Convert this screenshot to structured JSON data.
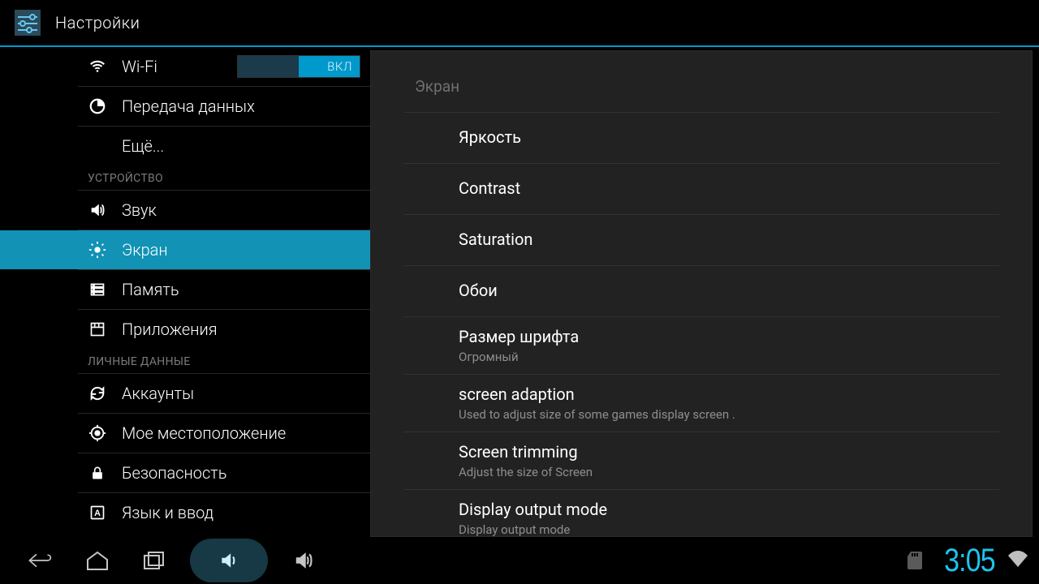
{
  "app": {
    "title": "Настройки"
  },
  "toggle": {
    "on_label": "ВКЛ"
  },
  "sidebar": {
    "items": [
      {
        "label": "Wi-Fi"
      },
      {
        "label": "Передача данных"
      },
      {
        "label": "Ещё..."
      },
      {
        "label": "Звук"
      },
      {
        "label": "Экран"
      },
      {
        "label": "Память"
      },
      {
        "label": "Приложения"
      },
      {
        "label": "Аккаунты"
      },
      {
        "label": "Мое местоположение"
      },
      {
        "label": "Безопасность"
      },
      {
        "label": "Язык и ввод"
      }
    ],
    "sections": {
      "device": "УСТРОЙСТВО",
      "personal": "ЛИЧНЫЕ ДАННЫЕ"
    }
  },
  "panel": {
    "header": "Экран",
    "rows": [
      {
        "title": "Яркость"
      },
      {
        "title": "Contrast"
      },
      {
        "title": "Saturation"
      },
      {
        "title": "Обои"
      },
      {
        "title": "Размер шрифта",
        "sub": "Огромный"
      },
      {
        "title": "screen adaption",
        "sub": "Used to adjust size of some games display screen ."
      },
      {
        "title": "Screen trimming",
        "sub": "Adjust the size of Screen"
      },
      {
        "title": "Display output mode",
        "sub": "Display output mode"
      }
    ]
  },
  "status": {
    "time": "3:05"
  }
}
